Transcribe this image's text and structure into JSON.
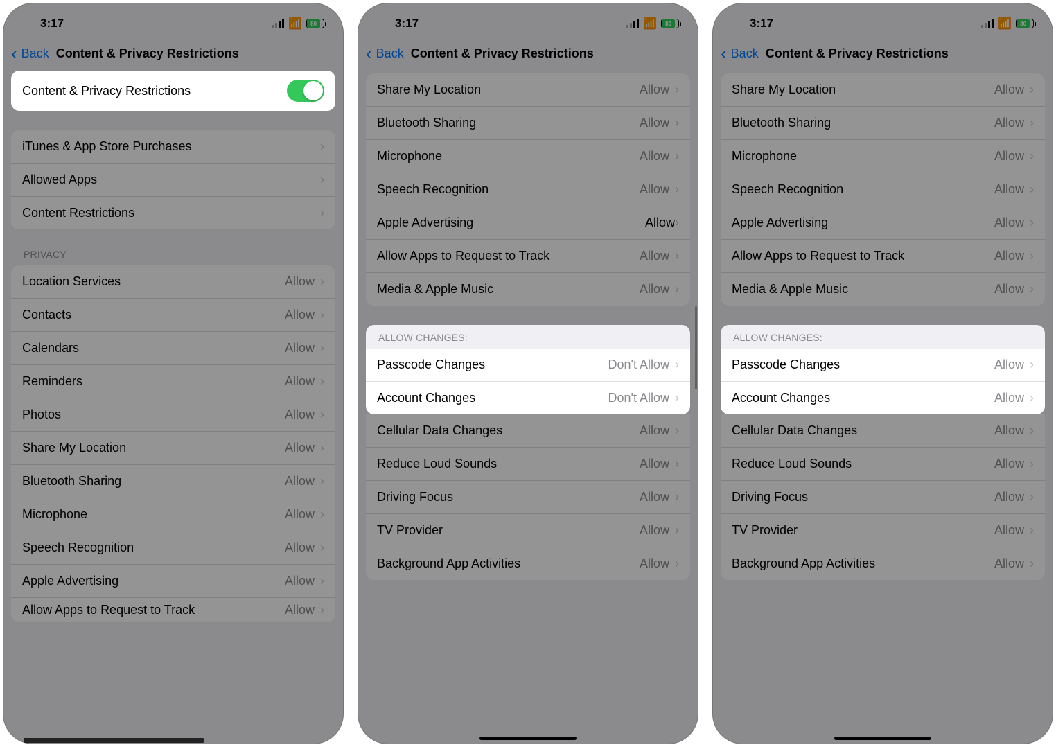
{
  "status": {
    "time": "3:17",
    "battery": "80"
  },
  "nav": {
    "back": "Back",
    "title": "Content & Privacy Restrictions"
  },
  "labels": {
    "allow": "Allow",
    "dont_allow": "Don't Allow",
    "privacy_header": "PRIVACY",
    "allow_changes_header": "ALLOW CHANGES:"
  },
  "screen1": {
    "toggle_label": "Content & Privacy Restrictions",
    "main_items": [
      "iTunes & App Store Purchases",
      "Allowed Apps",
      "Content Restrictions"
    ],
    "privacy_items": [
      "Location Services",
      "Contacts",
      "Calendars",
      "Reminders",
      "Photos",
      "Share My Location",
      "Bluetooth Sharing",
      "Microphone",
      "Speech Recognition",
      "Apple Advertising",
      "Allow Apps to Request to Track"
    ]
  },
  "screen2": {
    "upper_items": [
      "Share My Location",
      "Bluetooth Sharing",
      "Microphone",
      "Speech Recognition",
      "Apple Advertising",
      "Allow Apps to Request to Track",
      "Media & Apple Music"
    ],
    "changes_items": [
      {
        "label": "Passcode Changes",
        "value": "Don't Allow"
      },
      {
        "label": "Account Changes",
        "value": "Don't Allow"
      }
    ],
    "lower_items": [
      "Cellular Data Changes",
      "Reduce Loud Sounds",
      "Driving Focus",
      "TV Provider",
      "Background App Activities"
    ]
  },
  "screen3": {
    "upper_items": [
      "Share My Location",
      "Bluetooth Sharing",
      "Microphone",
      "Speech Recognition",
      "Apple Advertising",
      "Allow Apps to Request to Track",
      "Media & Apple Music"
    ],
    "changes_items": [
      {
        "label": "Passcode Changes",
        "value": "Allow"
      },
      {
        "label": "Account Changes",
        "value": "Allow"
      }
    ],
    "lower_items": [
      "Cellular Data Changes",
      "Reduce Loud Sounds",
      "Driving Focus",
      "TV Provider",
      "Background App Activities"
    ]
  }
}
